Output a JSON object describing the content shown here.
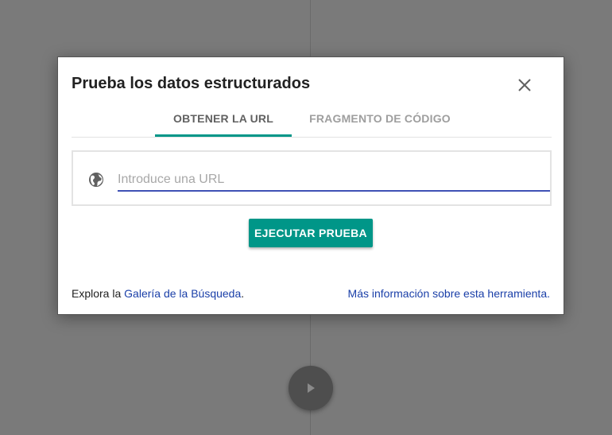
{
  "dialog": {
    "title": "Prueba los datos estructurados",
    "tabs": [
      {
        "label": "OBTENER LA URL",
        "active": true
      },
      {
        "label": "FRAGMENTO DE CÓDIGO",
        "active": false
      }
    ],
    "url_input": {
      "value": "",
      "placeholder": "Introduce una URL"
    },
    "run_button": {
      "label": "EJECUTAR PRUEBA"
    },
    "footer": {
      "explore_prefix": "Explora la ",
      "gallery_link": "Galería de la Búsqueda",
      "explore_suffix": ".",
      "more_info_link": "Más información sobre esta herramienta",
      "more_info_suffix": "."
    }
  },
  "colors": {
    "accent": "#009688",
    "input_underline": "#3f51b5",
    "link": "#1a3fa8",
    "overlay": "#7a7a7a"
  },
  "icons": {
    "close": "close-icon",
    "globe": "globe-icon",
    "play": "play-icon"
  }
}
